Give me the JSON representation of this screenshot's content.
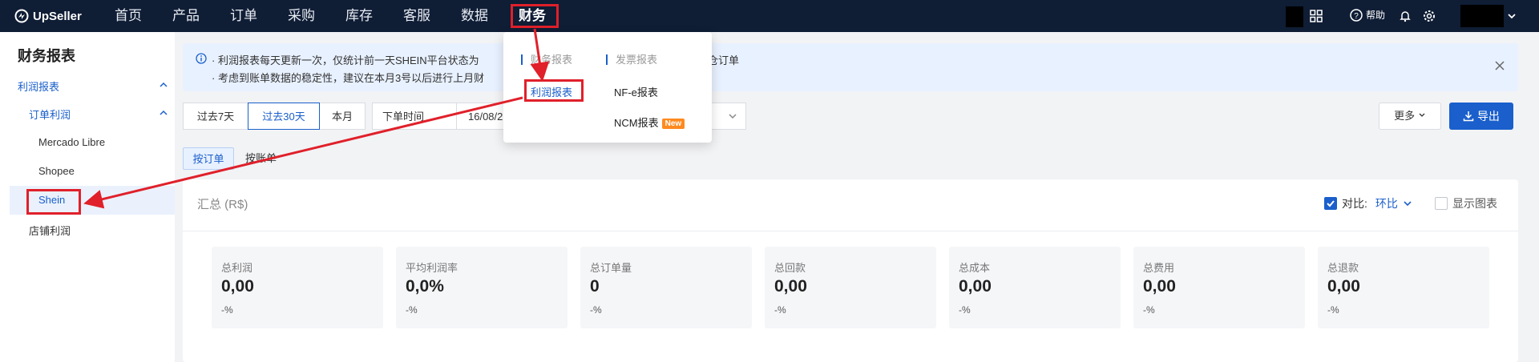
{
  "brand": "UpSeller",
  "nav": {
    "items": [
      "首页",
      "产品",
      "订单",
      "采购",
      "库存",
      "客服",
      "数据",
      "财务"
    ],
    "active": "财务",
    "help_label": "帮助"
  },
  "sidebar": {
    "title": "财务报表",
    "profit_report": "利润报表",
    "order_profit": "订单利润",
    "platforms": [
      "Mercado Libre",
      "Shopee",
      "Shein"
    ],
    "store_profit": "店铺利润"
  },
  "notice": {
    "line1_a": "· 利润报表每天更新一次，仅统计前一天SHEIN平台状态为",
    "line1_b": "仓订单",
    "line2": "· 考虑到账单数据的稳定性，建议在本月3号以后进行上月财"
  },
  "toolbar": {
    "ranges": [
      "过去7天",
      "过去30天",
      "本月"
    ],
    "active_range": "过去30天",
    "time_type": "下单时间",
    "date_from": "16/08/2",
    "more_label": "更多",
    "export_label": "导出"
  },
  "view_tabs": [
    "按订单",
    "按账单"
  ],
  "summary": {
    "title": "汇总 (R$)",
    "compare_label": "对比:",
    "compare_value": "环比",
    "compare_checked": true,
    "show_chart_label": "显示图表",
    "show_chart_checked": false,
    "metrics": [
      {
        "label": "总利润",
        "value": "0,00",
        "delta": "-%"
      },
      {
        "label": "平均利润率",
        "value": "0,0%",
        "delta": "-%"
      },
      {
        "label": "总订单量",
        "value": "0",
        "delta": "-%"
      },
      {
        "label": "总回款",
        "value": "0,00",
        "delta": "-%"
      },
      {
        "label": "总成本",
        "value": "0,00",
        "delta": "-%"
      },
      {
        "label": "总费用",
        "value": "0,00",
        "delta": "-%"
      },
      {
        "label": "总退款",
        "value": "0,00",
        "delta": "-%"
      }
    ]
  },
  "dropdown": {
    "col1_header": "财务报表",
    "col2_header": "发票报表",
    "profit_report": "利润报表",
    "nfe_report": "NF-e报表",
    "ncm_report": "NCM报表",
    "new_badge": "New"
  },
  "colors": {
    "nav_bg": "#0f1d35",
    "accent": "#1a5fcb",
    "highlight_red": "#e0202a",
    "badge_orange": "#ff8a1f"
  }
}
